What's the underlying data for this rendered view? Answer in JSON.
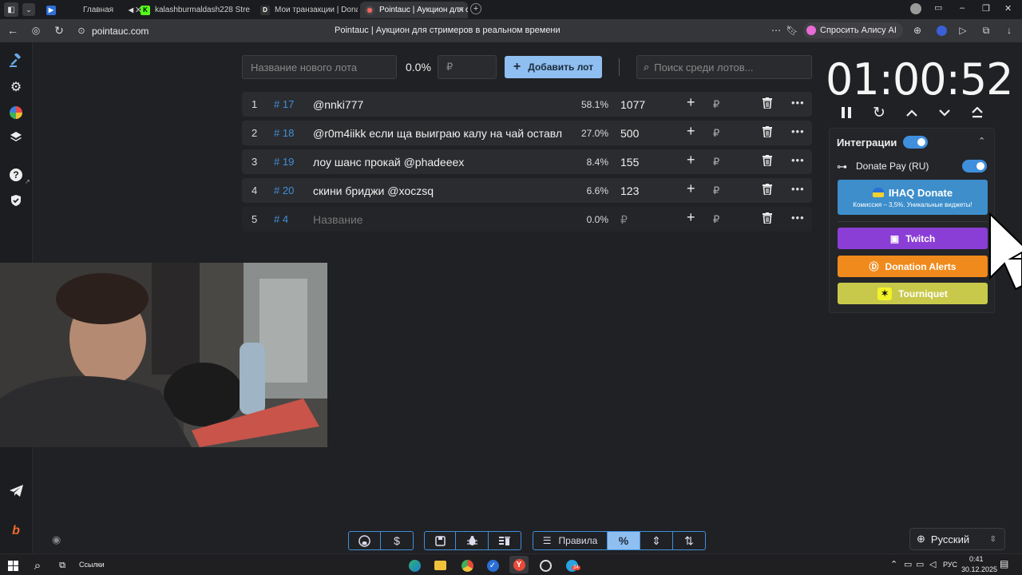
{
  "browser": {
    "tabs": [
      {
        "label": "Главная"
      },
      {
        "label": "kalashburmaldash228 Stre"
      },
      {
        "label": "Мои транзакции | Donate"
      },
      {
        "label": "Pointauc | Аукцион для с"
      }
    ],
    "url": "pointauc.com",
    "page_title": "Pointauc | Аукцион для стримеров в реальном времени",
    "alice_label": "Спросить Алису AI"
  },
  "toolbar": {
    "new_lot_placeholder": "Название нового лота",
    "percent": "0.0%",
    "currency": "₽",
    "add_lot_label": "Добавить лот",
    "search_placeholder": "Поиск среди лотов..."
  },
  "lots": [
    {
      "index": "1",
      "id": "# 17",
      "name": "@nnki777",
      "percent": "58.1%",
      "amount": "1077",
      "currency": "₽"
    },
    {
      "index": "2",
      "id": "# 18",
      "name": "@r0m4iikk если ща выиграю калу на чай оставл",
      "percent": "27.0%",
      "amount": "500",
      "currency": "₽"
    },
    {
      "index": "3",
      "id": "# 19",
      "name": "лоу шанс прокай @phadeeex",
      "percent": "8.4%",
      "amount": "155",
      "currency": "₽"
    },
    {
      "index": "4",
      "id": "# 20",
      "name": "скини бриджи @xoczsq",
      "percent": "6.6%",
      "amount": "123",
      "currency": "₽"
    },
    {
      "index": "5",
      "id": "# 4",
      "name": "Название",
      "percent": "0.0%",
      "amount": "₽",
      "currency": "₽"
    }
  ],
  "timer": {
    "value": "01:00:52"
  },
  "integrations": {
    "title": "Интеграции",
    "donatepay_label": "Donate Pay (RU)",
    "ihaq_label": "IHAQ Donate",
    "ihaq_sub": "Комиссия – 3,5%. Уникальные виджеты!",
    "twitch_label": "Twitch",
    "donation_alerts_label": "Donation Alerts",
    "tourniquet_label": "Tourniquet"
  },
  "bottom": {
    "rules_label": "Правила",
    "language": "Русский"
  },
  "taskbar": {
    "links_label": "Ссылки",
    "lang": "РУС",
    "time": "0:41",
    "date": "30.12.2025",
    "telegram_badge": "24"
  },
  "colors": {
    "accent": "#3f8fdc",
    "add_button": "#8fbff0",
    "twitch": "#8a3ed6",
    "donation_alerts": "#f08a1c",
    "tourniquet": "#c8c94a",
    "ihaq": "#3d8ecb"
  }
}
